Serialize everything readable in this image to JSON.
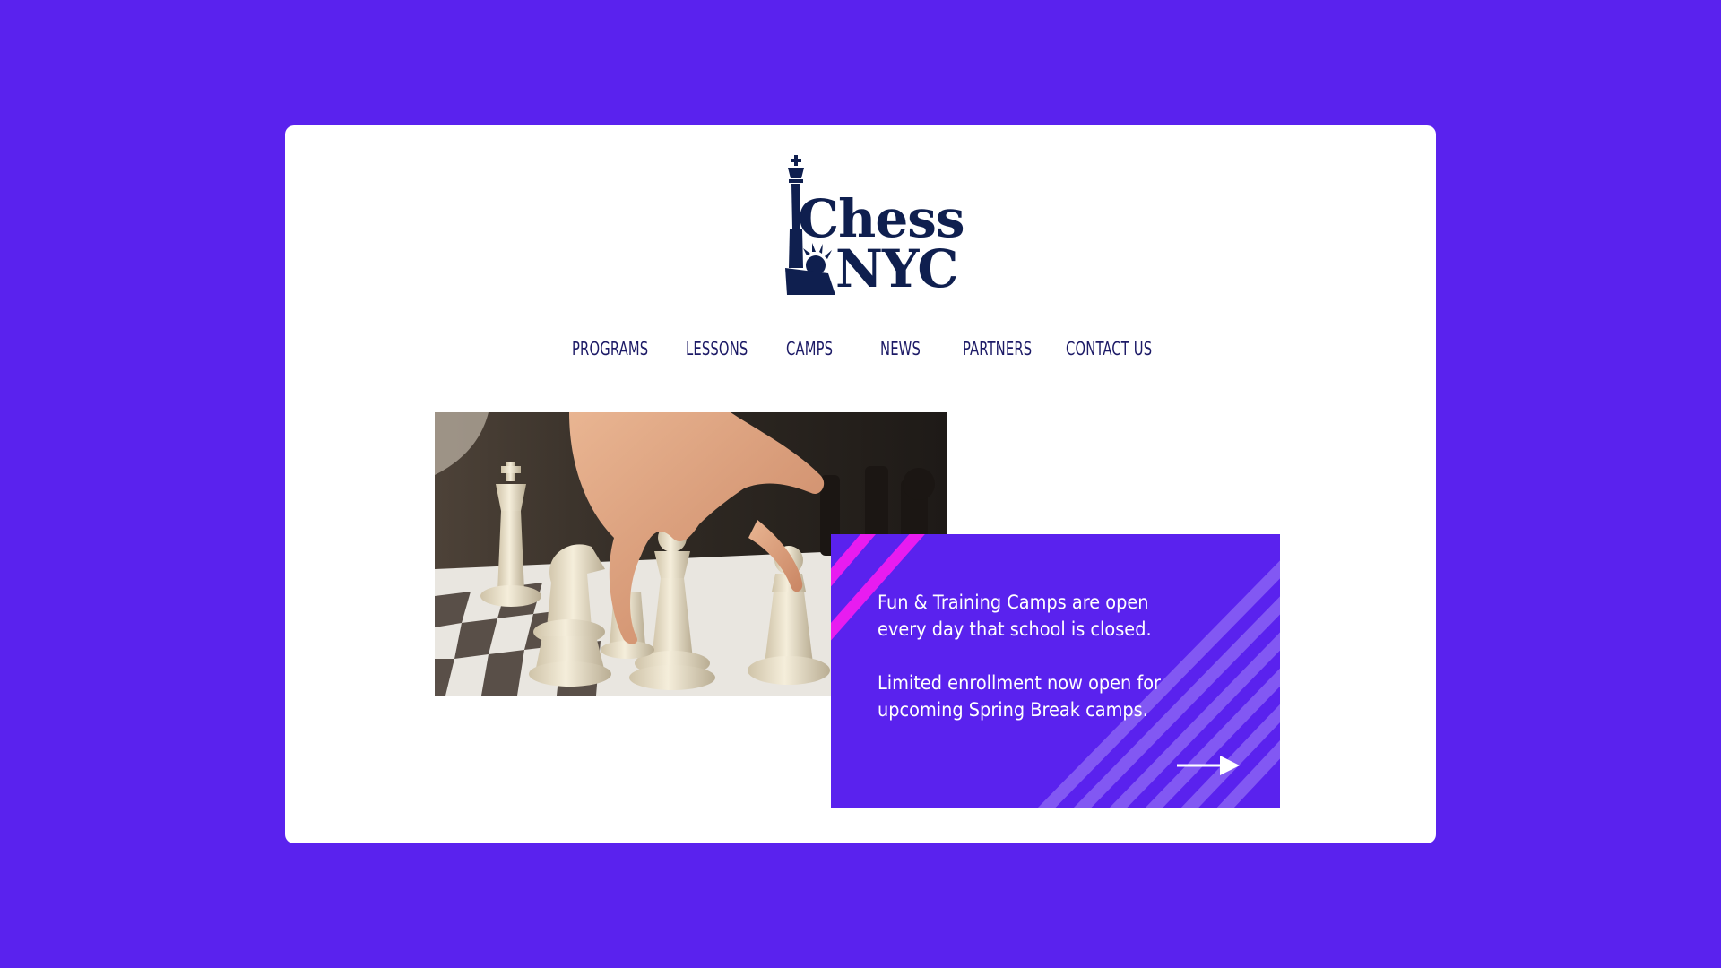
{
  "logo": {
    "line1": "Chess",
    "line2": "NYC"
  },
  "nav": {
    "items": [
      "PROGRAMS",
      "LESSONS",
      "CAMPS",
      "NEWS",
      "PARTNERS",
      "CONTACT US"
    ]
  },
  "hero": {
    "image_icon": "chess-hand-photo"
  },
  "promo": {
    "paragraph1": "Fun & Training Camps are open every day that school is closed.",
    "paragraph2": "Limited enrollment now open for upcoming Spring Break camps.",
    "arrow_icon": "arrow-right-icon"
  },
  "colors": {
    "background": "#5a22ee",
    "card": "#ffffff",
    "nav_text": "#1c1a66",
    "logo": "#0f1f4f",
    "accent_magenta": "#e81cf0"
  }
}
